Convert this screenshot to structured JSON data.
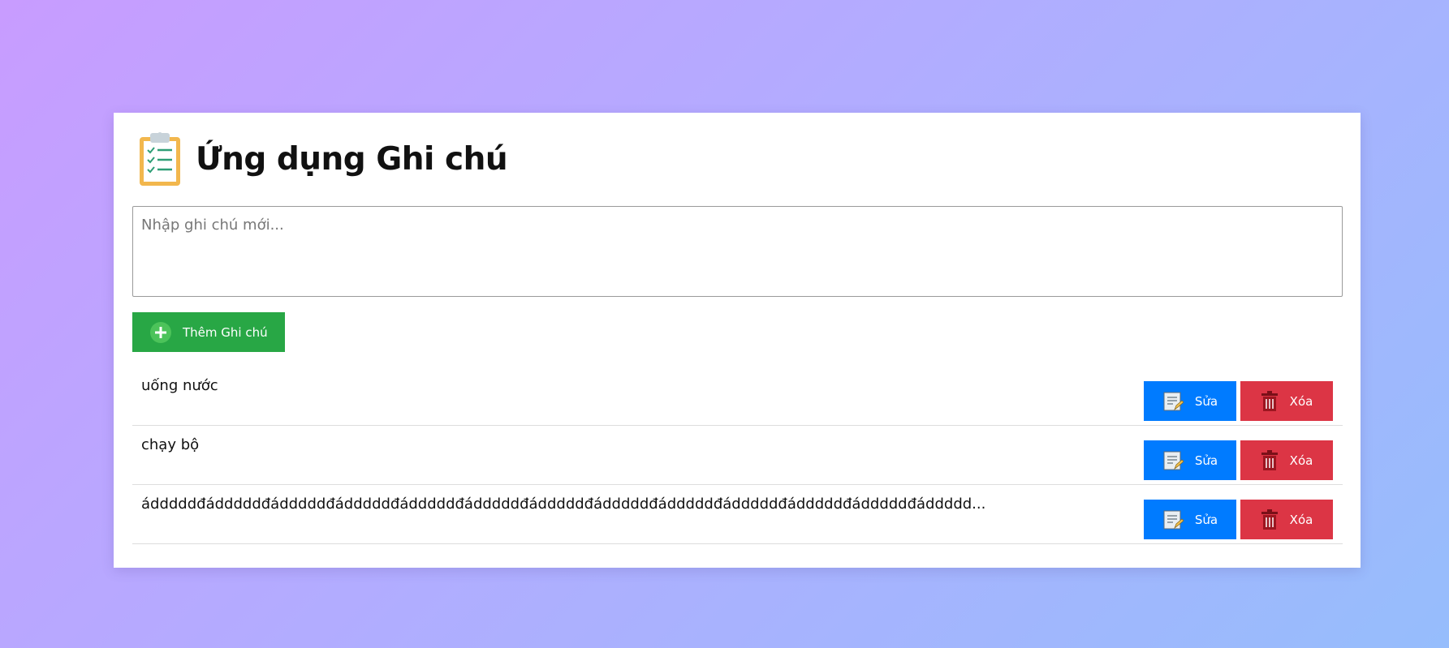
{
  "app": {
    "title": "Ứng dụng Ghi chú",
    "logo_icon": "clipboard-checklist-icon"
  },
  "input": {
    "placeholder": "Nhập ghi chú mới...",
    "value": ""
  },
  "add_button": {
    "label": "Thêm Ghi chú",
    "icon": "plus-circle-icon"
  },
  "notes": [
    {
      "text": "uống nước",
      "edit_label": "Sửa",
      "delete_label": "Xóa"
    },
    {
      "text": "chạy bộ",
      "edit_label": "Sửa",
      "delete_label": "Xóa"
    },
    {
      "text": "ádddddđádddddđádddddđádddddđádddddđádddddđádddddđádddddđádddddđádddddđádddddđádddddđáddddd...",
      "edit_label": "Sửa",
      "delete_label": "Xóa"
    }
  ],
  "colors": {
    "add": "#28a745",
    "edit": "#007bff",
    "delete": "#dc3545"
  }
}
